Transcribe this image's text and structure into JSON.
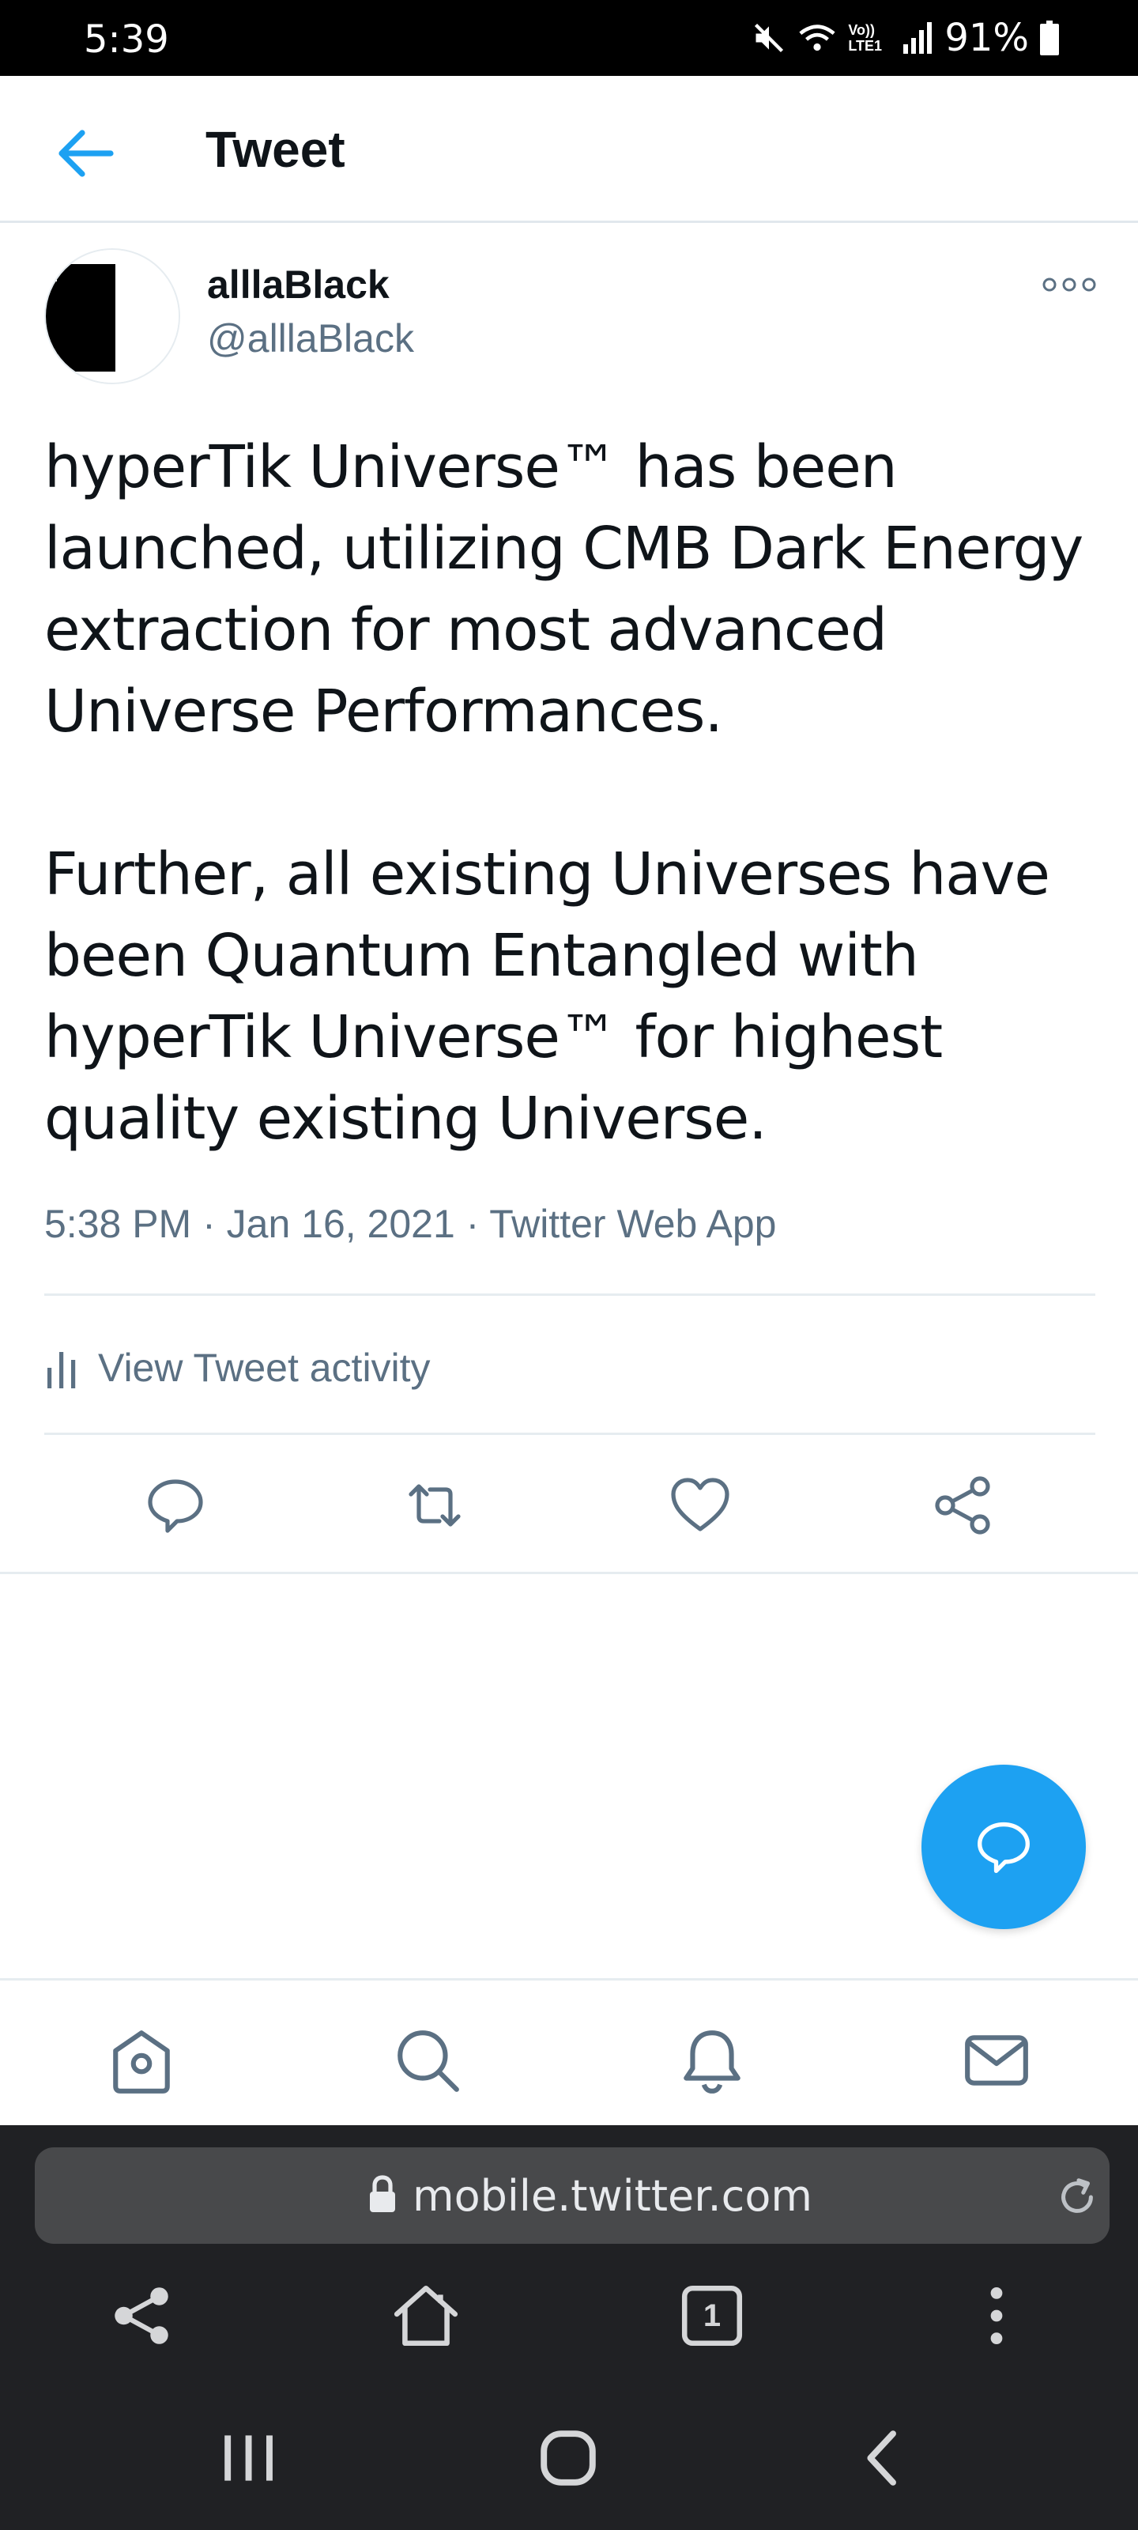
{
  "status_bar": {
    "time": "5:39",
    "network_label": "Vo)) LTE1",
    "battery": "91%"
  },
  "header": {
    "title": "Tweet"
  },
  "tweet": {
    "author_name": "alllaBlack",
    "author_handle": "@alllaBlack",
    "paragraphs": [
      "hyperTik Universe™ has been launched, utilizing CMB Dark Energy extraction for most advanced Universe Performances.",
      "Further, all existing Universes have been Quantum Entangled with hyperTik Universe™ for highest quality existing Universe."
    ],
    "meta": "5:38 PM · Jan 16, 2021 · Twitter Web App",
    "activity_label": "View Tweet activity"
  },
  "actions": {
    "icons": [
      "reply-icon",
      "retweet-icon",
      "like-icon",
      "share-icon"
    ]
  },
  "bottom_nav": {
    "icons": [
      "home-icon",
      "search-icon",
      "notifications-icon",
      "messages-icon"
    ]
  },
  "browser": {
    "url": "mobile.twitter.com",
    "tab_count": "1"
  },
  "colors": {
    "accent": "#1da1f2",
    "text_primary": "#0f1419",
    "text_secondary": "#5b7083",
    "divider": "#e6ecf0",
    "browser_bg": "#202124"
  }
}
